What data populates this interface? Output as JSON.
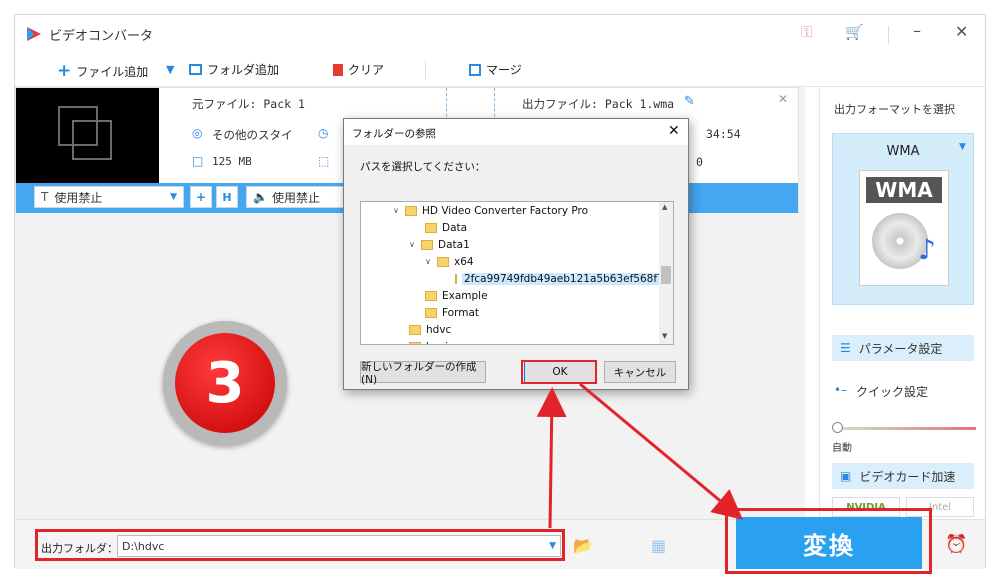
{
  "window": {
    "title": "ビデオコンバータ"
  },
  "toolbar": {
    "add_file": "ファイル追加",
    "add_folder": "フォルダ追加",
    "clear": "クリア",
    "merge": "マージ"
  },
  "task": {
    "source_label": "元ファイル: Pack 1",
    "output_label": "出力ファイル: Pack 1.wma",
    "meta_left": "その他のスタイ",
    "size": "125 MB",
    "duration_out": "34:54",
    "out_size": "0",
    "subtitle_select": "使用禁止",
    "audio_select": "使用禁止"
  },
  "dialog": {
    "title": "フォルダーの参照",
    "prompt": "パスを選択してください：",
    "tree": [
      "HD Video Converter Factory Pro",
      "Data",
      "Data1",
      "x64",
      "2fca99749fdb49aeb121a5b63ef568f7",
      "Example",
      "Format",
      "hdvc",
      "kuping"
    ],
    "new_folder": "新しいフォルダーの作成(N)",
    "ok": "OK",
    "cancel": "キャンセル"
  },
  "step_badge": "3",
  "right_panel": {
    "heading": "出力フォーマットを選択",
    "format": "WMA",
    "format_icon_text": "WMA",
    "params": "パラメータ設定",
    "quick": "クイック設定",
    "auto": "自動",
    "gpu": "ビデオカード加速",
    "nvidia": "NVIDIA",
    "intel": "Intel"
  },
  "bottom": {
    "output_folder_label": "出力フォルダ：",
    "output_path": "D:\\hdvc",
    "convert": "変換"
  },
  "colors": {
    "accent": "#2aa0f0",
    "annotation": "#e2232a"
  }
}
